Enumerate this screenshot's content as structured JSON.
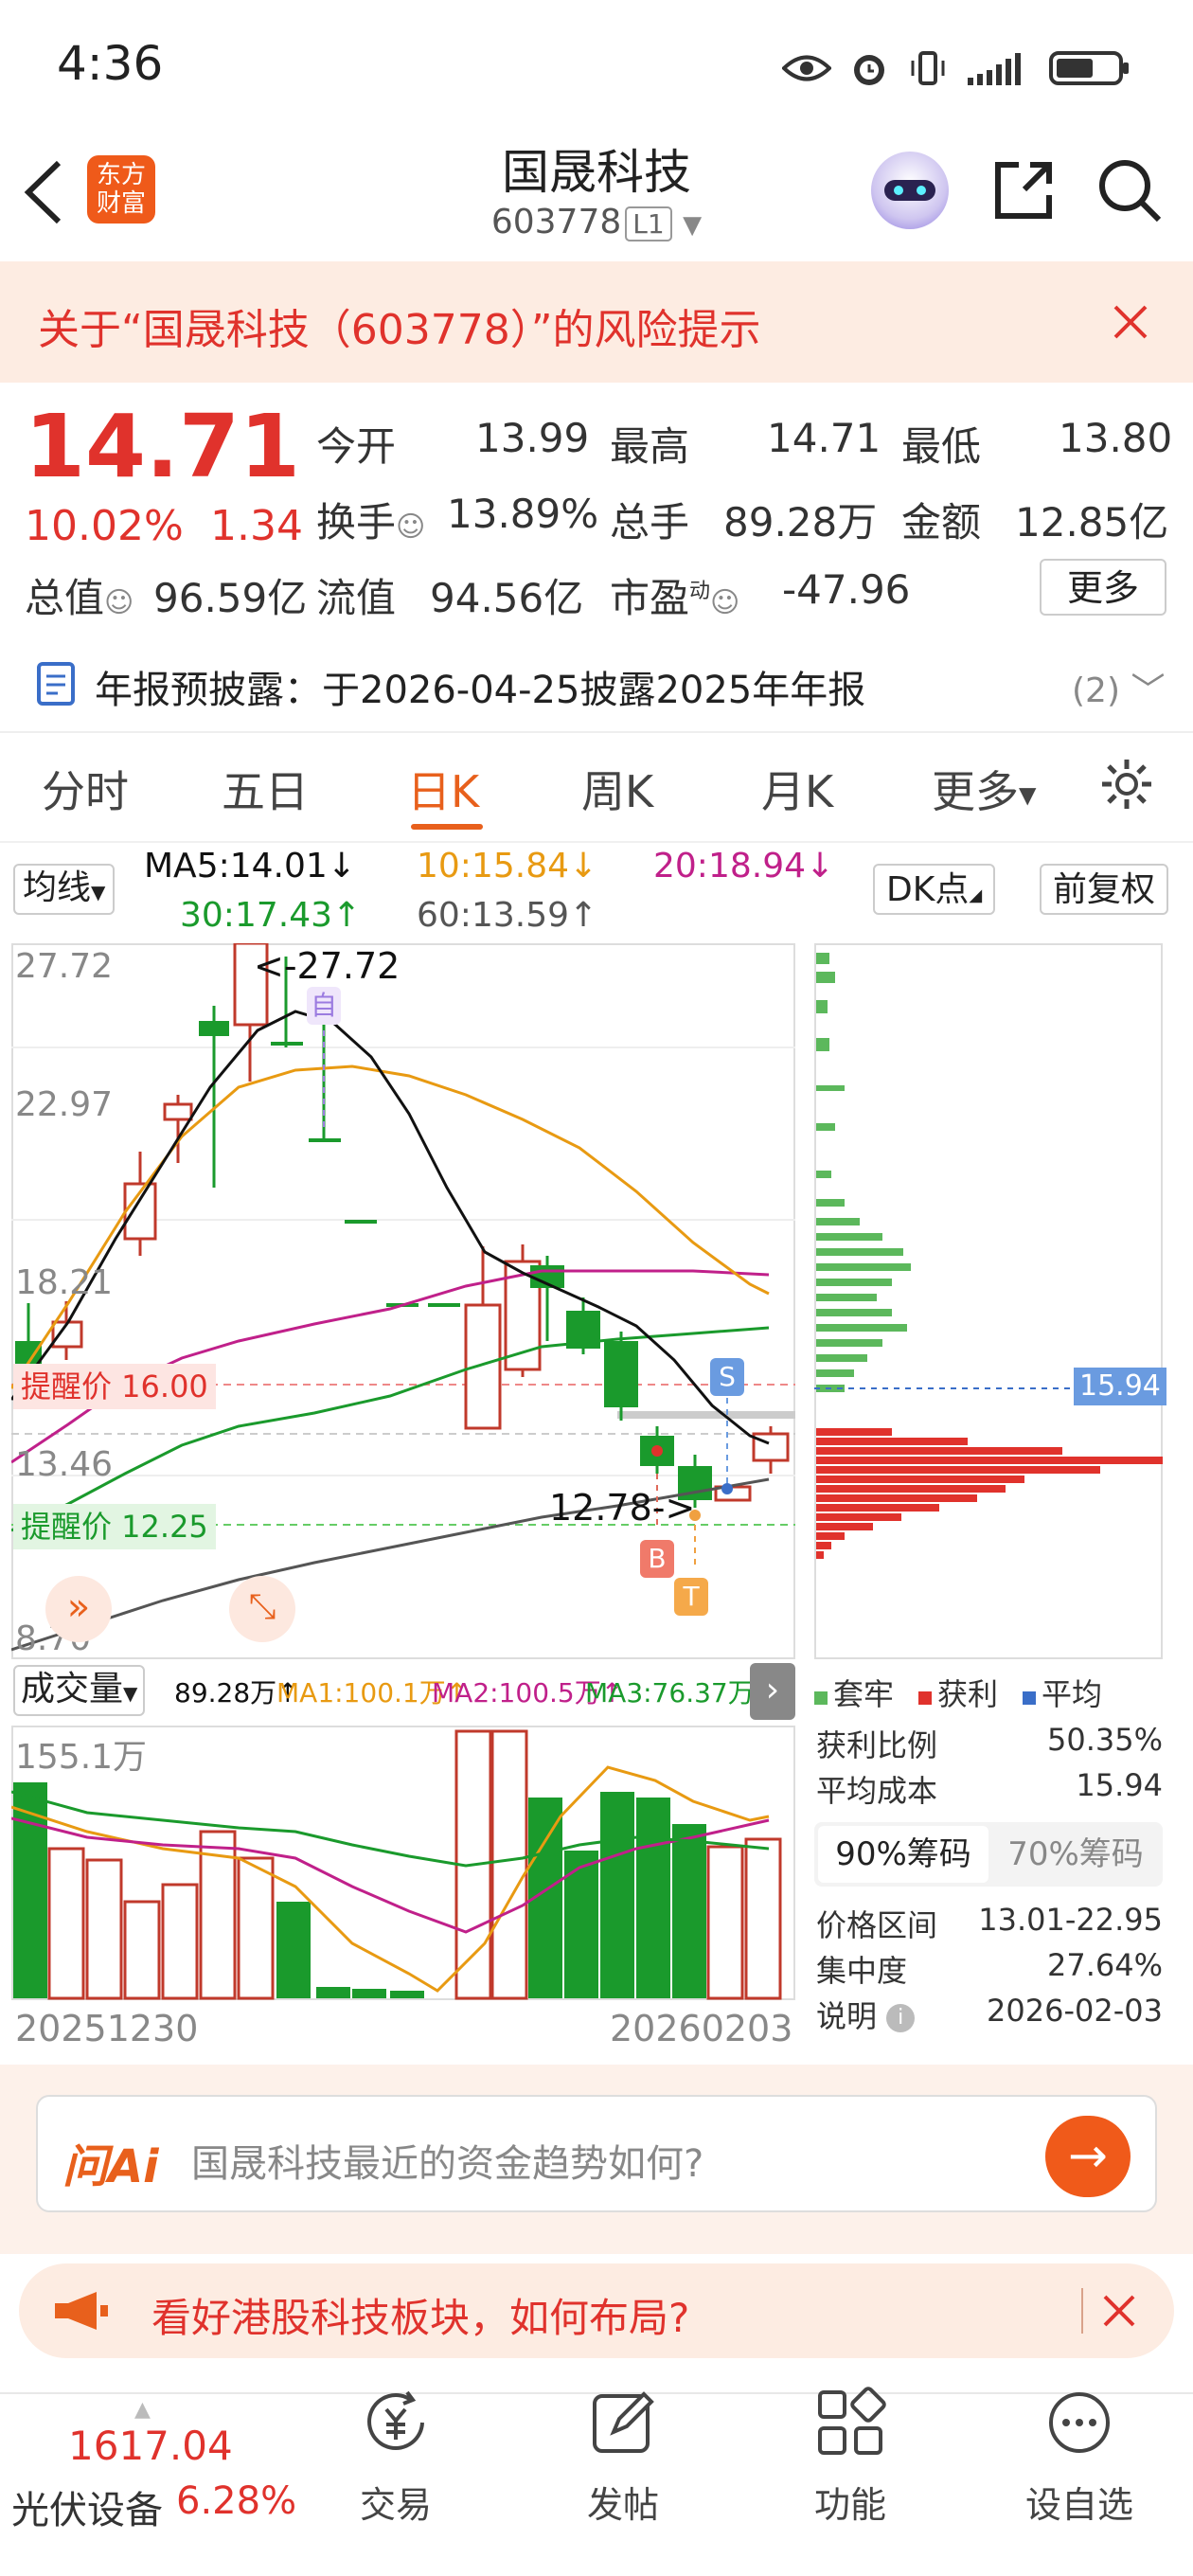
{
  "status_bar": {
    "time": "4:36"
  },
  "header": {
    "title": "国晟科技",
    "code": "603778",
    "level": "L1",
    "logo": "东方\n财富"
  },
  "risk_banner": {
    "text": "关于“国晟科技（603778）”的风险提示"
  },
  "quote": {
    "price": "14.71",
    "change_pct": "10.02%",
    "change": "1.34",
    "open_label": "今开",
    "open": "13.99",
    "high_label": "最高",
    "high": "14.71",
    "low_label": "最低",
    "low": "13.80",
    "turnover_label": "换手",
    "turnover": "13.89%",
    "volume_label": "总手",
    "volume": "89.28万",
    "amount_label": "金额",
    "amount": "12.85亿",
    "mktcap_label": "总值",
    "mktcap": "96.59亿",
    "float_label": "流值",
    "float": "94.56亿",
    "pe_label": "市盈",
    "pe_sup": "动",
    "pe": "-47.96",
    "more_button": "更多"
  },
  "notice": {
    "text": "年报预披露：于2026-04-25披露2025年年报",
    "count": "(2)"
  },
  "tabs": [
    "分时",
    "五日",
    "日K",
    "周K",
    "月K",
    "更多"
  ],
  "ma_bar": {
    "selector": "均线",
    "ma5": "MA5:14.01↓",
    "ma10": "10:15.84↓",
    "ma20": "20:18.94↓",
    "ma30": "30:17.43↑",
    "ma60": "60:13.59↑",
    "dk_button": "DK点",
    "adjust_button": "前复权"
  },
  "kchart": {
    "y_labels": [
      "27.72",
      "22.97",
      "18.21",
      "13.46",
      "8.70"
    ],
    "max_marker": "<-27.72",
    "min_marker": "12.78->",
    "alert_upper": "提醒价 16.00",
    "alert_lower": "提醒价 12.25",
    "tag_zi": "自",
    "tag_s": "S",
    "tag_b": "B",
    "tag_t": "T"
  },
  "volume_bar": {
    "selector": "成交量",
    "vol": "89.28万↑",
    "ma1": "MA1:100.1万↑",
    "ma2": "MA2:100.5万↑",
    "ma3": "MA3:76.37万↓",
    "y_max": "155.1万",
    "date_start": "20251230",
    "date_end": "20260203"
  },
  "chip_dist": {
    "avg_cost_tag": "15.94",
    "legend": [
      "套牢",
      "获利",
      "平均"
    ],
    "rows": [
      {
        "label": "获利比例",
        "value": "50.35%"
      },
      {
        "label": "平均成本",
        "value": "15.94"
      }
    ],
    "tab_90": "90%筹码",
    "tab_70": "70%筹码",
    "rows2": [
      {
        "label": "价格区间",
        "value": "13.01-22.95"
      },
      {
        "label": "集中度",
        "value": "27.64%"
      },
      {
        "label": "说明",
        "value": "2026-02-03"
      }
    ]
  },
  "ai_box": {
    "brand": "问Ai",
    "placeholder": "国晟科技最近的资金趋势如何?"
  },
  "promo": {
    "text": "看好港股科技板块，如何布局?"
  },
  "bottom_nav": {
    "index_value": "1617.04",
    "index_name": "光伏设备",
    "index_change": "6.28%",
    "items": [
      "交易",
      "发帖",
      "功能",
      "设自选"
    ]
  },
  "colors": {
    "up": "#e0322c",
    "down": "#1a9a2c",
    "accent": "#e8601c",
    "ma5": "#111111",
    "ma10": "#e89a12",
    "ma20": "#c0208a",
    "ma30": "#1a9a2c",
    "ma60": "#555555"
  }
}
